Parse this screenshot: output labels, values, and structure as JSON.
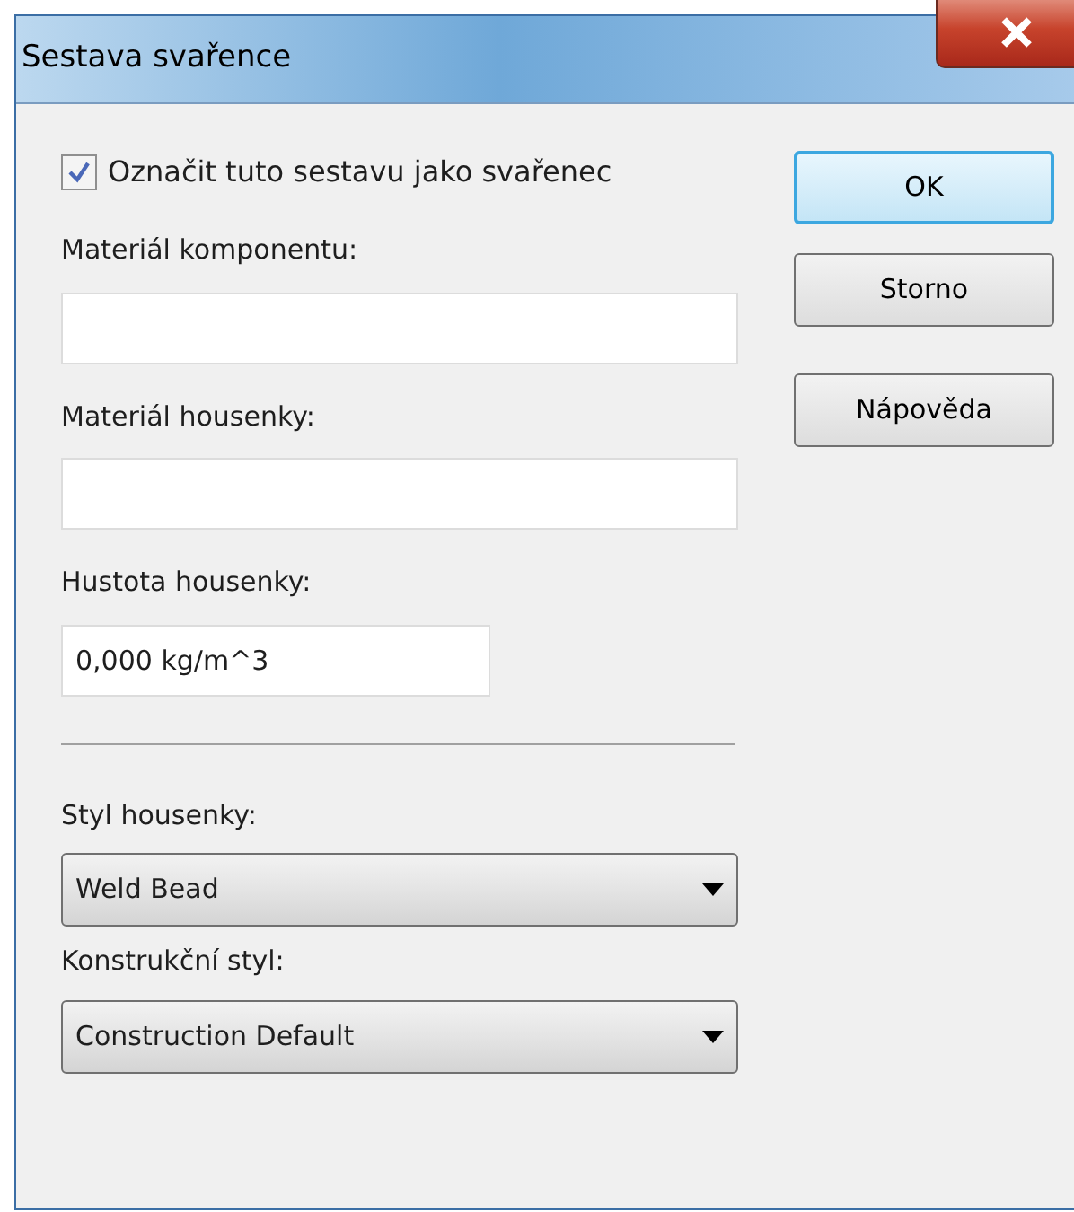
{
  "window": {
    "title": "Sestava svařence"
  },
  "checkbox": {
    "label": "Označit tuto sestavu jako svařenec",
    "checked": true
  },
  "fields": [
    {
      "kind": "text",
      "label": "Materiál komponentu:",
      "wide": true
    },
    {
      "kind": "text",
      "label": "Materiál housenky:",
      "wide": true
    },
    {
      "kind": "text",
      "label": "Hustota housenky:",
      "value": "0,000 kg/m^3",
      "wide": false
    },
    {
      "kind": "separator"
    },
    {
      "kind": "select",
      "label": "Styl housenky:",
      "value": "Weld Bead",
      "wide": true
    },
    {
      "kind": "select",
      "label": "Konstrukční styl:",
      "value": "Construction Default",
      "wide": true
    }
  ],
  "buttons": [
    {
      "label": "OK",
      "default": true
    },
    {
      "label": "Storno",
      "default": false
    },
    {
      "label": "Nápověda",
      "default": false
    }
  ]
}
